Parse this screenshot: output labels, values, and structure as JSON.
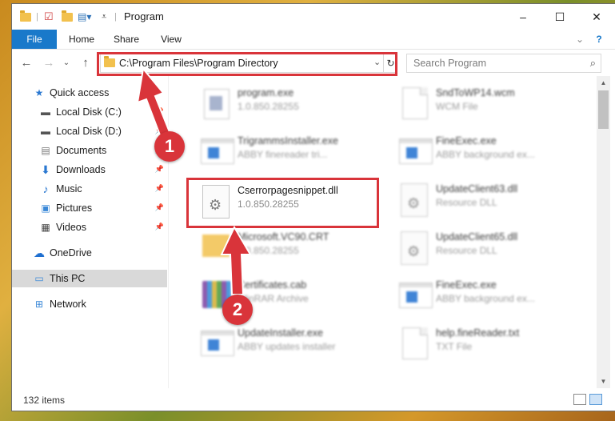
{
  "window": {
    "title": "Program",
    "controls": {
      "minimize": "–",
      "maximize": "☐",
      "close": "✕"
    }
  },
  "ribbon": {
    "tabs": [
      "File",
      "Home",
      "Share",
      "View"
    ],
    "help": "?"
  },
  "navigation": {
    "back": "←",
    "forward": "→",
    "recent": "⌄",
    "up": "↑",
    "address": "C:\\Program Files\\Program Directory",
    "search_placeholder": "Search Program"
  },
  "sidebar": {
    "items": [
      {
        "label": "Quick access",
        "icon": "star-icon"
      },
      {
        "label": "Local Disk (C:)",
        "icon": "drive-icon"
      },
      {
        "label": "Local Disk (D:)",
        "icon": "drive-icon"
      },
      {
        "label": "Documents",
        "icon": "documents-icon"
      },
      {
        "label": "Downloads",
        "icon": "download-icon"
      },
      {
        "label": "Music",
        "icon": "music-icon"
      },
      {
        "label": "Pictures",
        "icon": "pictures-icon"
      },
      {
        "label": "Videos",
        "icon": "videos-icon"
      },
      {
        "label": "OneDrive",
        "icon": "cloud-icon"
      },
      {
        "label": "This PC",
        "icon": "computer-icon"
      },
      {
        "label": "Network",
        "icon": "network-icon"
      }
    ]
  },
  "files": [
    {
      "name": "program.exe",
      "desc": "1.0.850.28255",
      "icon": "exe-icon"
    },
    {
      "name": "SndToWP14.wcm",
      "desc": "WCM File",
      "icon": "document-icon"
    },
    {
      "name": "TrigrammsInstaller.exe",
      "desc": "ABBY finereader tri...",
      "icon": "app-icon"
    },
    {
      "name": "FineExec.exe",
      "desc": "ABBY background ex...",
      "icon": "app-icon"
    },
    {
      "name": "Cserrorpagesnippet.dll",
      "desc": "1.0.850.28255",
      "icon": "dll-icon"
    },
    {
      "name": "UpdateClient63.dll",
      "desc": "Resource DLL",
      "icon": "dll-icon"
    },
    {
      "name": "Microsoft.VC90.CRT",
      "desc": "1.0.850.28255",
      "icon": "folder-icon"
    },
    {
      "name": "UpdateClient65.dll",
      "desc": "Resource DLL",
      "icon": "dll-icon"
    },
    {
      "name": "Certificates.cab",
      "desc": "WinRAR Archive",
      "icon": "archive-icon"
    },
    {
      "name": "FineExec.exe",
      "desc": "ABBY background ex...",
      "icon": "app-icon"
    },
    {
      "name": "UpdateInstaller.exe",
      "desc": "ABBY updates installer",
      "icon": "app-icon"
    },
    {
      "name": "help.fineReader.txt",
      "desc": "TXT File",
      "icon": "document-icon"
    }
  ],
  "status": {
    "item_count": "132 items"
  },
  "callouts": {
    "step1": "1",
    "step2": "2"
  },
  "colors": {
    "accent": "#1979ca",
    "highlight": "#d9343a",
    "selected": "#d9d9d9"
  }
}
